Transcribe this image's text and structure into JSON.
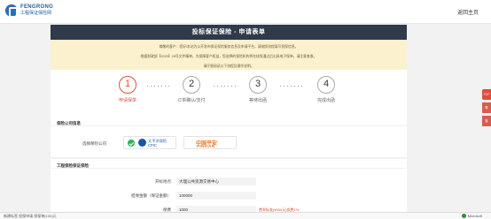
{
  "header": {
    "logo_en": "FENGRONG",
    "logo_cn": "工程保证保险网",
    "home_link": "返回主页"
  },
  "title": "投标保证保险 - 申请表单",
  "notice": {
    "line1": "尊敬的客户：您好!本站为公开发布保证保险服务信息及申请平台，请按照流程填写投保信息。",
    "line2": "根据财政部【2020】28号文件精神，为保障客户权益，您选择的保险机构将在核保通过后出具电子保单，请注意查收。",
    "line3": "请仔细阅读以下流程及操作说明。"
  },
  "steps": [
    {
      "number": "1",
      "label": "申请保单"
    },
    {
      "number": "2",
      "label": "订单确认/支付"
    },
    {
      "number": "3",
      "label": "等待出函"
    },
    {
      "number": "4",
      "label": "完成出函"
    }
  ],
  "dots": "·······",
  "company_section": {
    "title": "保险公司信息",
    "label": "选择保险公司",
    "cpic_name": "太平洋保险",
    "cpic_code": "CPIC",
    "pingan_cn": "中国平安",
    "pingan_en": "PINGAN"
  },
  "form_section": {
    "title": "工程保险保证保险",
    "rows": [
      {
        "label": "开标地点",
        "value": "大理公共资源交易中心",
        "hint": ""
      },
      {
        "label": "担保金额（保证金额）",
        "value": "100000",
        "hint": ""
      },
      {
        "label": "保费",
        "value": "1000",
        "hint": "费率标准(¥400元)保费1%"
      }
    ]
  },
  "side_tools": [
    "TOP",
    "联",
    "客"
  ],
  "taskbar": {
    "left": "新建标签    投保申请    投保单(100)元",
    "right": "Microsoft"
  },
  "colors": {
    "accent": "#e14d3a",
    "title_bar": "#2f3a4a",
    "notice_bg": "#fbf1cf"
  }
}
